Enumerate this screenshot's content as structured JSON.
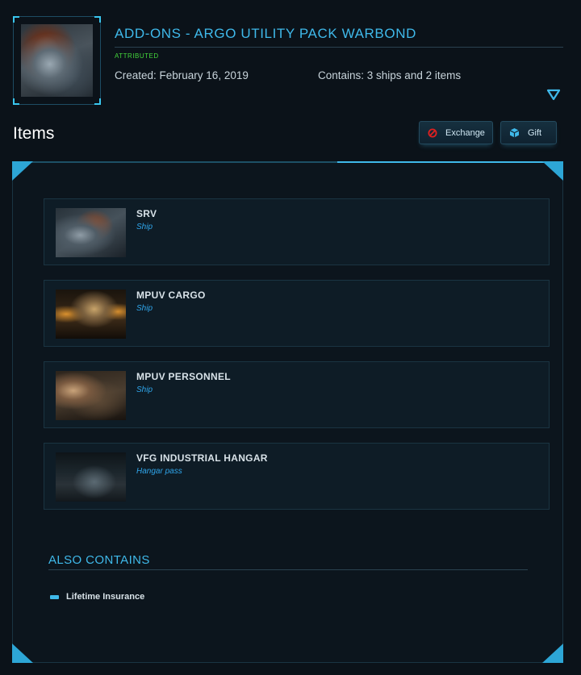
{
  "header": {
    "title": "ADD-ONS - ARGO UTILITY PACK WARBOND",
    "status": "ATTRIBUTED",
    "created": "Created: February 16, 2019",
    "contains": "Contains: 3 ships and 2 items"
  },
  "items_section": {
    "heading": "Items",
    "exchange_label": "Exchange",
    "gift_label": "Gift"
  },
  "items": [
    {
      "name": "SRV",
      "kind": "Ship"
    },
    {
      "name": "MPUV CARGO",
      "kind": "Ship"
    },
    {
      "name": "MPUV PERSONNEL",
      "kind": "Ship"
    },
    {
      "name": "VFG INDUSTRIAL HANGAR",
      "kind": "Hangar pass"
    }
  ],
  "also_contains": {
    "heading": "ALSO CONTAINS",
    "entries": [
      "Lifetime Insurance"
    ]
  },
  "icons": {
    "expand": "chevron-down-icon",
    "exchange": "no-entry-icon",
    "gift": "gift-cube-icon",
    "bullet": "dash-icon"
  },
  "colors": {
    "accent": "#3fb9ea",
    "status_green": "#44d63b",
    "exchange_red": "#e02020",
    "background": "#0b1219"
  }
}
